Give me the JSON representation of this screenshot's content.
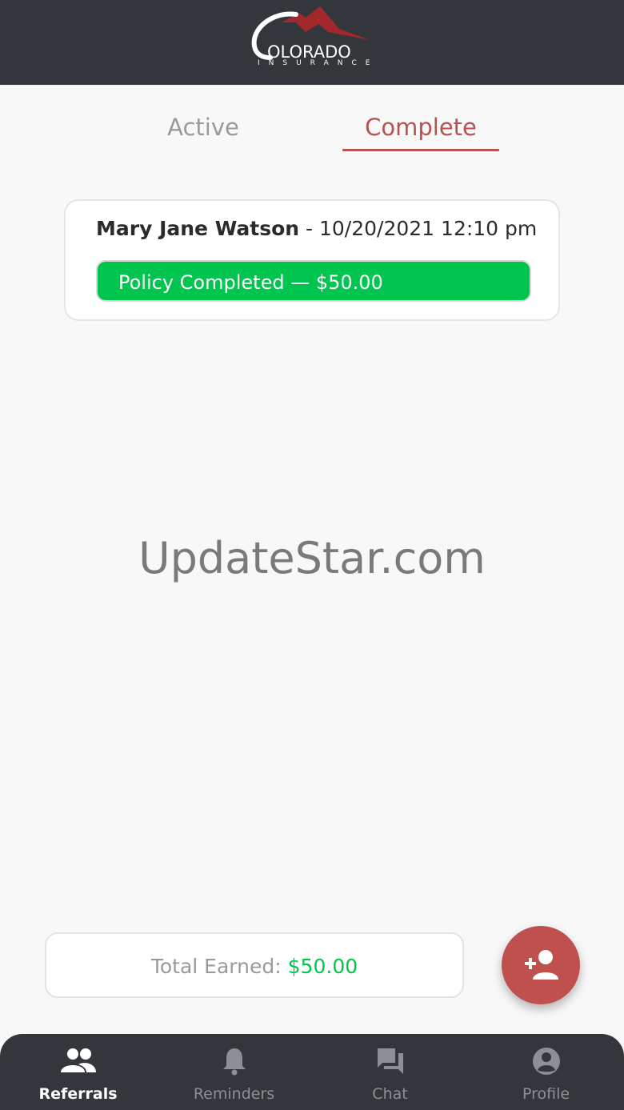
{
  "brand": {
    "word": "OLORADO",
    "sub": "INSURANCE",
    "colors": {
      "header": "#33373c",
      "accent": "#b8524f",
      "mountain": "#a3282c",
      "success": "#00c64f"
    }
  },
  "tabs": [
    {
      "label": "Active",
      "selected": false
    },
    {
      "label": "Complete",
      "selected": true
    }
  ],
  "referrals": [
    {
      "name": "Mary Jane Watson",
      "separator": " - ",
      "datetime": "10/20/2021 12:10 pm",
      "status": "Policy Completed — $50.00"
    }
  ],
  "watermark": "UpdateStar.com",
  "summary": {
    "label": "Total Earned:",
    "value": "$50.00"
  },
  "fab": {
    "icon": "add-person-icon"
  },
  "nav": [
    {
      "label": "Referrals",
      "icon": "people-icon",
      "selected": true
    },
    {
      "label": "Reminders",
      "icon": "bell-icon",
      "selected": false
    },
    {
      "label": "Chat",
      "icon": "chat-bubbles-icon",
      "selected": false
    },
    {
      "label": "Profile",
      "icon": "account-circle-icon",
      "selected": false
    }
  ]
}
